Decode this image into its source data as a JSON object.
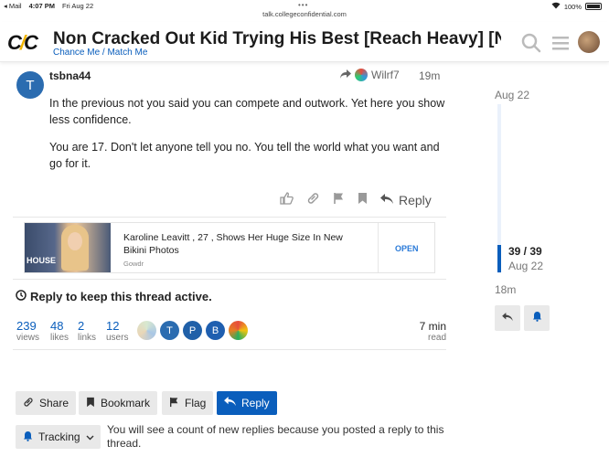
{
  "status": {
    "carrier": "◂ Mail",
    "time": "4:07 PM",
    "date": "Fri Aug 22",
    "battery": "100%",
    "url": "talk.collegeconfidential.com"
  },
  "header": {
    "logo_left": "C",
    "logo_slash": "/",
    "logo_right": "C",
    "title": "Non Cracked Out Kid Trying His Best [Reach Heavy] [NC …",
    "breadcrumb": "Chance Me / Match Me"
  },
  "post": {
    "avatar_letter": "T",
    "username": "tsbna44",
    "reply_to": "Wilrf7",
    "time": "19m",
    "paragraphs": [
      "In the previous not you said you can compete and outwork. Yet here you show less confidence.",
      "You are 17. Don't let anyone tell you no. You tell the world what you want and go for it."
    ],
    "reply_label": "Reply"
  },
  "ad": {
    "image_text": "HOUSE",
    "title": "Karoline Leavitt , 27 , Shows Her Huge Size In New Bikini Photos",
    "source": "Gowdr",
    "open_label": "OPEN"
  },
  "keep_active": "Reply to keep this thread active.",
  "stats": [
    {
      "num": "239",
      "label": "views"
    },
    {
      "num": "48",
      "label": "likes"
    },
    {
      "num": "2",
      "label": "links"
    },
    {
      "num": "12",
      "label": "users"
    }
  ],
  "participants": [
    "T",
    "P",
    "B"
  ],
  "read_time": {
    "num": "7 min",
    "label": "read"
  },
  "buttons": {
    "share": "Share",
    "bookmark": "Bookmark",
    "flag": "Flag",
    "reply": "Reply",
    "tracking": "Tracking"
  },
  "tracking_desc": "You will see a count of new replies because you posted a reply to this thread.",
  "timeline": {
    "top_date": "Aug 22",
    "count": "39 / 39",
    "current_date": "Aug 22",
    "last_activity": "18m"
  },
  "colors": {
    "accent": "#0a5ebc",
    "avatar_t": "#2b6cb0",
    "avatar_p": "#2060a8",
    "avatar_b": "#1f5fb0"
  }
}
